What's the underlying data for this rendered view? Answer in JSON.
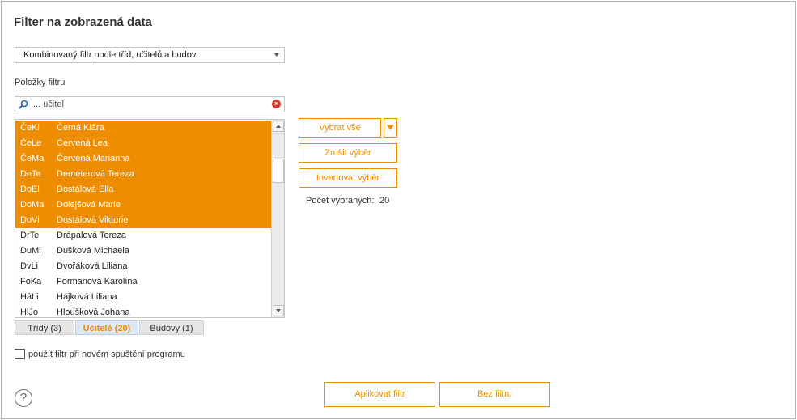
{
  "dialog": {
    "title": "Filter na zobrazená data",
    "filter_type": "Kombinovaný filtr podle tříd, učitelů a budov",
    "items_label": "Položky filtru",
    "search_value": "... učitel",
    "items": [
      {
        "code": "ČeKl",
        "name": "Černá Klára",
        "selected": true
      },
      {
        "code": "ČeLe",
        "name": "Červená Lea",
        "selected": true
      },
      {
        "code": "ČeMa",
        "name": "Červená Marianna",
        "selected": true
      },
      {
        "code": "DeTe",
        "name": "Demeterová Tereza",
        "selected": true
      },
      {
        "code": "DoEl",
        "name": "Dostálová Ella",
        "selected": true
      },
      {
        "code": "DoMa",
        "name": "Dolejšová Marie",
        "selected": true
      },
      {
        "code": "DoVi",
        "name": "Dostálová Viktorie",
        "selected": true
      },
      {
        "code": "DrTe",
        "name": "Drápalová Tereza",
        "selected": false
      },
      {
        "code": "DuMi",
        "name": "Dušková Michaela",
        "selected": false
      },
      {
        "code": "DvLi",
        "name": "Dvořáková Liliana",
        "selected": false
      },
      {
        "code": "FoKa",
        "name": "Formanová Karolína",
        "selected": false
      },
      {
        "code": "HáLi",
        "name": "Hájková Liliana",
        "selected": false
      },
      {
        "code": "HlJo",
        "name": "Hloušková Johana",
        "selected": false
      }
    ],
    "tabs": [
      {
        "label": "Třídy (3)",
        "active": false
      },
      {
        "label": "Učitelé (20)",
        "active": true
      },
      {
        "label": "Budovy (1)",
        "active": false
      }
    ],
    "buttons": {
      "select_all": "Vybrat vše",
      "cancel_selection": "Zrušit výběr",
      "invert_selection": "Invertovat výběr",
      "apply": "Aplikovat filtr",
      "no_filter": "Bez filtru"
    },
    "count_label": "Počet vybraných:",
    "count_value": "20",
    "checkbox_label": "použít filtr při novém spuštění programu",
    "help": "?",
    "accent_color": "#ee8d00"
  }
}
